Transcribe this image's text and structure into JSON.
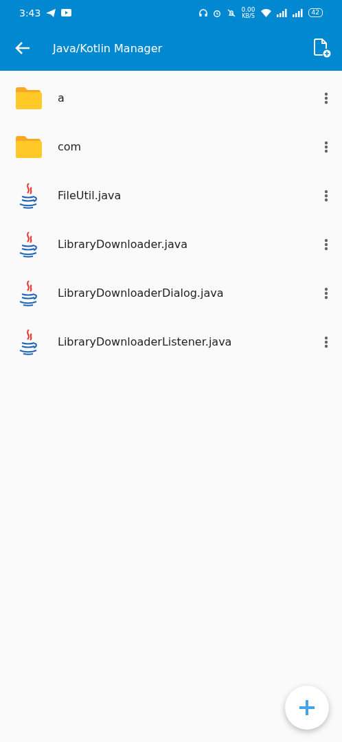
{
  "status_bar": {
    "time": "3:43",
    "speed": "0.00",
    "speed_unit": "KB/S",
    "battery": "42"
  },
  "app_bar": {
    "title": "Java/Kotlin Manager"
  },
  "files": [
    {
      "name": "a",
      "kind": "folder"
    },
    {
      "name": "com",
      "kind": "folder"
    },
    {
      "name": "FileUtil.java",
      "kind": "java"
    },
    {
      "name": "LibraryDownloader.java",
      "kind": "java"
    },
    {
      "name": "LibraryDownloaderDialog.java",
      "kind": "java"
    },
    {
      "name": "LibraryDownloaderListener.java",
      "kind": "java"
    }
  ]
}
